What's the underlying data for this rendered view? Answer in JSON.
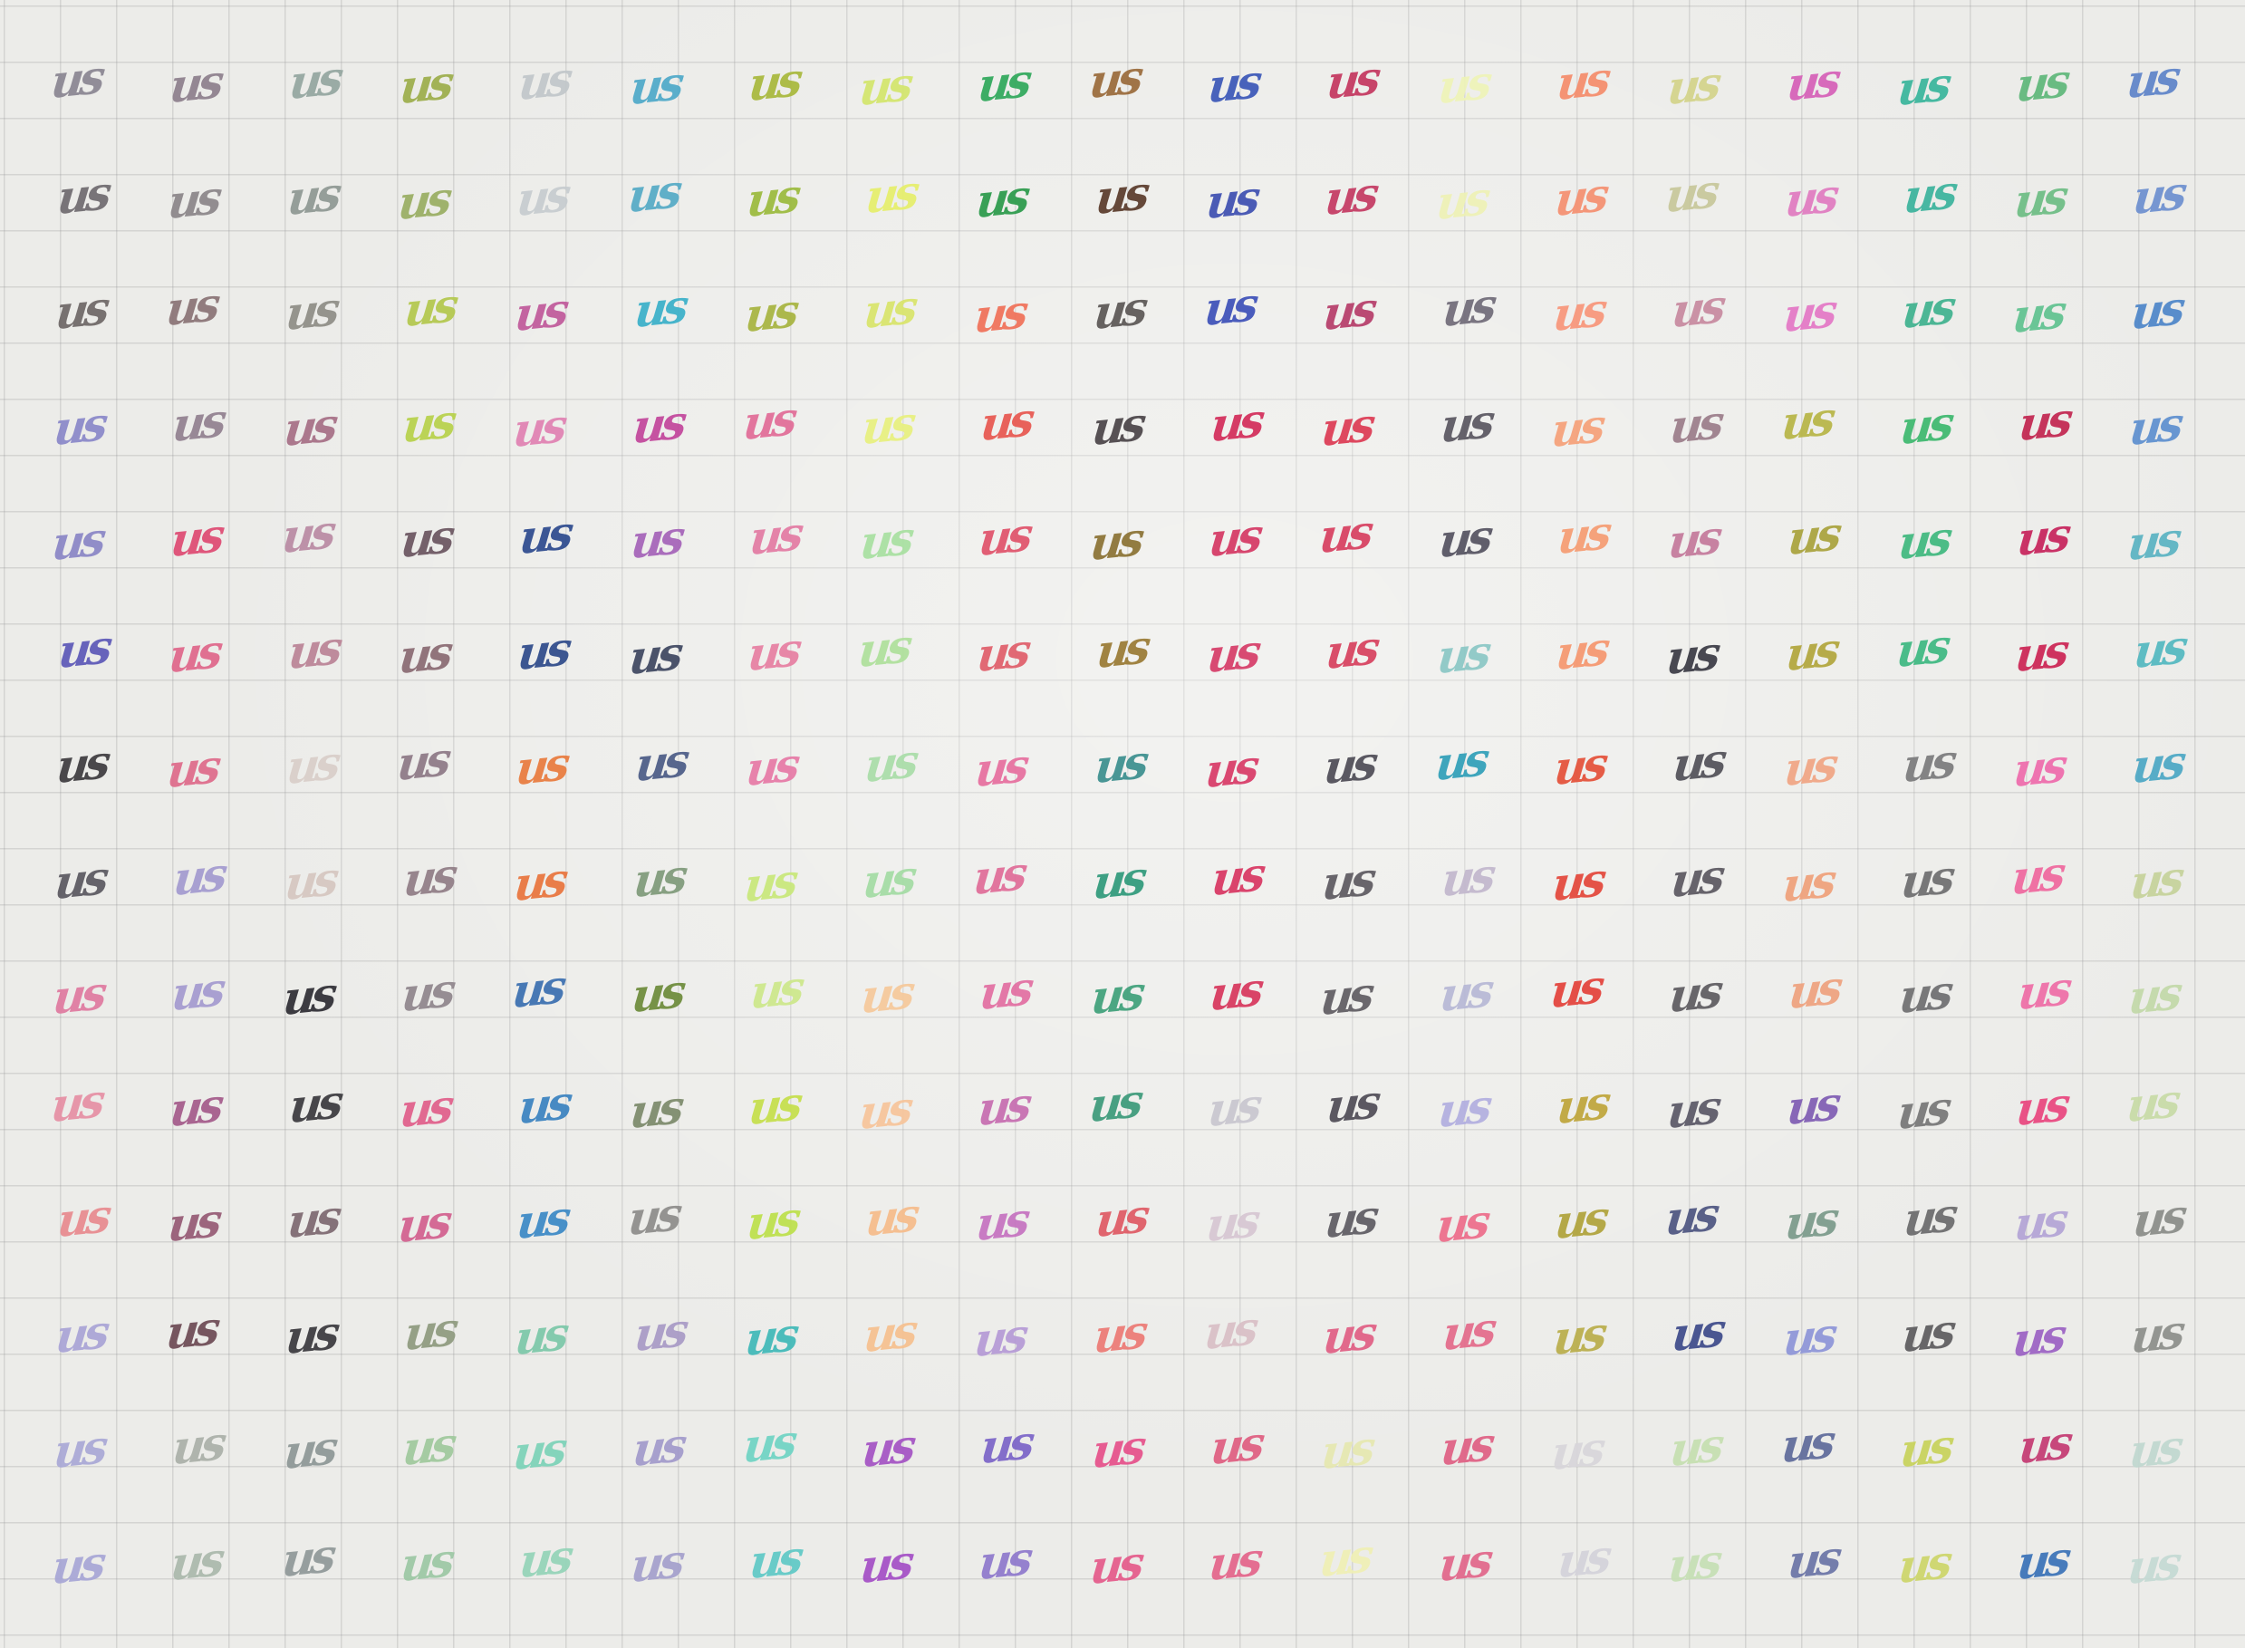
{
  "sample_text": "us",
  "grid": {
    "rows": 14,
    "cols": 19
  },
  "ink_colors": [
    [
      "#8a8592",
      "#8d7f8c",
      "#94a6a0",
      "#9cae4a",
      "#c1c7ca",
      "#4ea9c9",
      "#a8b83b",
      "#d3e66c",
      "#2fa85a",
      "#9a6a3a",
      "#3a57b8",
      "#c4365e",
      "#eef4b8",
      "#f58c6a",
      "#d3d48a",
      "#d65fb8",
      "#38b59b",
      "#5eb77a",
      "#5d83c9"
    ],
    [
      "#6f6a6f",
      "#8b8589",
      "#8e9893",
      "#99ae62",
      "#c6cccf",
      "#55aac6",
      "#9bba3c",
      "#e6ef6a",
      "#2a9a4a",
      "#5a3a2a",
      "#3e4fb1",
      "#c43962",
      "#eef2b5",
      "#f58f70",
      "#c7c79a",
      "#e07bc0",
      "#3bb39c",
      "#6dbd84",
      "#6d8fd0"
    ],
    [
      "#6e6766",
      "#8a7375",
      "#8e8d86",
      "#b3c84c",
      "#c0599a",
      "#39b0c9",
      "#a7b43f",
      "#d9e56a",
      "#f07058",
      "#5b5655",
      "#3d50b8",
      "#b63d69",
      "#706b78",
      "#f8967a",
      "#c78aa0",
      "#e477c6",
      "#3fb28e",
      "#5fc28f",
      "#4d86c9"
    ],
    [
      "#8a88c9",
      "#91808f",
      "#a66f86",
      "#b7d14a",
      "#e081b2",
      "#c2459b",
      "#e16b97",
      "#e8f07e",
      "#e8574f",
      "#4a4448",
      "#d32c5a",
      "#dd3a53",
      "#5a5660",
      "#f6a078",
      "#9b7d8a",
      "#b7b545",
      "#3db86e",
      "#c2254f",
      "#5d8fcf"
    ],
    [
      "#8a86c6",
      "#de4a72",
      "#b98aa3",
      "#6a5560",
      "#2c4a8e",
      "#a563b8",
      "#e37aa3",
      "#a8e0a0",
      "#e0526a",
      "#8b7233",
      "#d53864",
      "#d73f5f",
      "#545260",
      "#f69c72",
      "#c4799b",
      "#a9a23c",
      "#3fb87e",
      "#c7235b",
      "#5ab3c2"
    ],
    [
      "#5c58b8",
      "#e0668a",
      "#bb8396",
      "#8a6a72",
      "#2d4a8a",
      "#3e4660",
      "#e77fa2",
      "#aee09b",
      "#e05e6a",
      "#9a7a34",
      "#d63c68",
      "#d7415e",
      "#8ac7c5",
      "#f6976e",
      "#3a3a44",
      "#b2a63c",
      "#3db881",
      "#cc2454",
      "#52b8c0"
    ],
    [
      "#3d3b3e",
      "#de6a8a",
      "#d9cec9",
      "#8d7886",
      "#e97a3d",
      "#4b5b86",
      "#e779a6",
      "#a9dda8",
      "#e76e9e",
      "#3b8f8e",
      "#d83a67",
      "#4e4c55",
      "#2f9fb8",
      "#e55038",
      "#515058",
      "#f1a583",
      "#7a7a7c",
      "#ef6aab",
      "#4ba7c5"
    ],
    [
      "#5a5860",
      "#a39ad0",
      "#d6c7c0",
      "#907d86",
      "#e9743c",
      "#7f9a7a",
      "#c8e87a",
      "#a4dca4",
      "#e06c98",
      "#2f9a7a",
      "#d93661",
      "#5d5a60",
      "#c2b7cd",
      "#e4463a",
      "#5b5860",
      "#f0a07a",
      "#6d6d6f",
      "#f0679e",
      "#c6d29a"
    ],
    [
      "#e07aa0",
      "#a49ad0",
      "#2e2d33",
      "#8f858c",
      "#3a6fb0",
      "#6c8b3a",
      "#cde88a",
      "#f6c89a",
      "#e26ea2",
      "#3fa07a",
      "#d8365c",
      "#5f5c62",
      "#b7b8d6",
      "#e4413a",
      "#5d5b60",
      "#efa27e",
      "#6e6e70",
      "#ef6ca6",
      "#c2d9a8"
    ],
    [
      "#e68fa4",
      "#a45a8a",
      "#3a393d",
      "#e15e8a",
      "#3a82c0",
      "#7c8a6a",
      "#c5df4a",
      "#f7c49a",
      "#c66cb0",
      "#3c9a7a",
      "#c9c6cf",
      "#4f4c56",
      "#b2aee0",
      "#bfa53a",
      "#5a5866",
      "#7f5cb3",
      "#767676",
      "#e9457e",
      "#c8dba6"
    ],
    [
      "#e88a8e",
      "#965a74",
      "#7d6870",
      "#d2608e",
      "#3b89c6",
      "#8d8c8a",
      "#bde04a",
      "#f6bc8a",
      "#c572c0",
      "#df5a64",
      "#d7c6d3",
      "#5d5b62",
      "#ed6c8a",
      "#b0a33a",
      "#4d5580",
      "#7b9a8a",
      "#6a6a6c",
      "#b3a4d6",
      "#8a8c88"
    ],
    [
      "#a9a4d6",
      "#6d4a54",
      "#3a393d",
      "#8e9a7e",
      "#7cc8a8",
      "#a89ac6",
      "#3fb9b8",
      "#f6c08e",
      "#b59ad6",
      "#ec7a74",
      "#d9bfc6",
      "#e05e84",
      "#e46a8a",
      "#b9ad4a",
      "#3d4a8a",
      "#8d95d8",
      "#5c5b5e",
      "#9b62c4",
      "#8c8e8a"
    ],
    [
      "#a9a8d6",
      "#aab0a8",
      "#8d9796",
      "#9fc99c",
      "#7cd2b8",
      "#a29acb",
      "#6fd4c4",
      "#a452c4",
      "#7b64c8",
      "#e6508a",
      "#e05d80",
      "#e6e8b0",
      "#e06084",
      "#d8d6da",
      "#c6dfb0",
      "#5e6a9a",
      "#c8d35a",
      "#c43a72",
      "#c0d8d0"
    ],
    [
      "#a7a6d6",
      "#aab8ac",
      "#8f9898",
      "#9cc8a4",
      "#94d4b8",
      "#a4a0cc",
      "#5ec9c6",
      "#a44ec6",
      "#8e78cc",
      "#e55a8a",
      "#e4648a",
      "#f0f0b4",
      "#e2668a",
      "#d4d2da",
      "#c6dfb4",
      "#6a74a6",
      "#cdd66a",
      "#3a72b8",
      "#c4dad4"
    ]
  ]
}
